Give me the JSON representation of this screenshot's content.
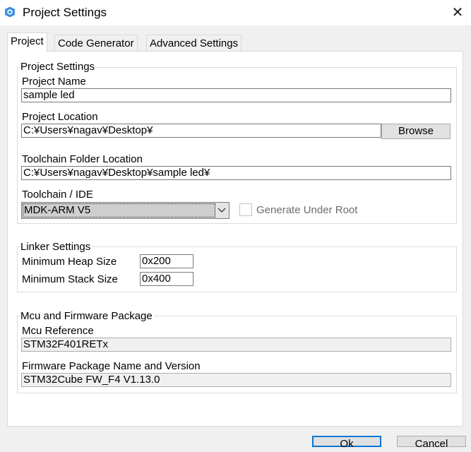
{
  "window": {
    "title": "Project Settings",
    "close_glyph": "✕"
  },
  "tabs": [
    {
      "label": "Project",
      "active": true
    },
    {
      "label": "Code Generator",
      "active": false
    },
    {
      "label": "Advanced Settings",
      "active": false
    }
  ],
  "project_settings": {
    "legend": "Project Settings",
    "project_name_label": "Project Name",
    "project_name_value": "sample led",
    "project_location_label": "Project Location",
    "project_location_value": "C:¥Users¥nagav¥Desktop¥",
    "browse_label": "Browse",
    "toolchain_folder_label": "Toolchain Folder Location",
    "toolchain_folder_value": "C:¥Users¥nagav¥Desktop¥sample led¥",
    "toolchain_ide_label": "Toolchain / IDE",
    "toolchain_ide_value": "MDK-ARM V5",
    "generate_under_root_label": "Generate Under Root",
    "generate_under_root_checked": false
  },
  "linker_settings": {
    "legend": "Linker Settings",
    "min_heap_label": "Minimum Heap Size",
    "min_heap_value": "0x200",
    "min_stack_label": "Minimum Stack Size",
    "min_stack_value": "0x400"
  },
  "mcu_firmware": {
    "legend": "Mcu and Firmware Package",
    "mcu_reference_label": "Mcu Reference",
    "mcu_reference_value": "STM32F401RETx",
    "firmware_label": "Firmware Package Name and Version",
    "firmware_value": "STM32Cube FW_F4 V1.13.0"
  },
  "footer": {
    "ok_label": "Ok",
    "cancel_label": "Cancel"
  },
  "colors": {
    "accent": "#0078d7",
    "window_bg": "#f0f0f0",
    "panel_bg": "#ffffff"
  }
}
